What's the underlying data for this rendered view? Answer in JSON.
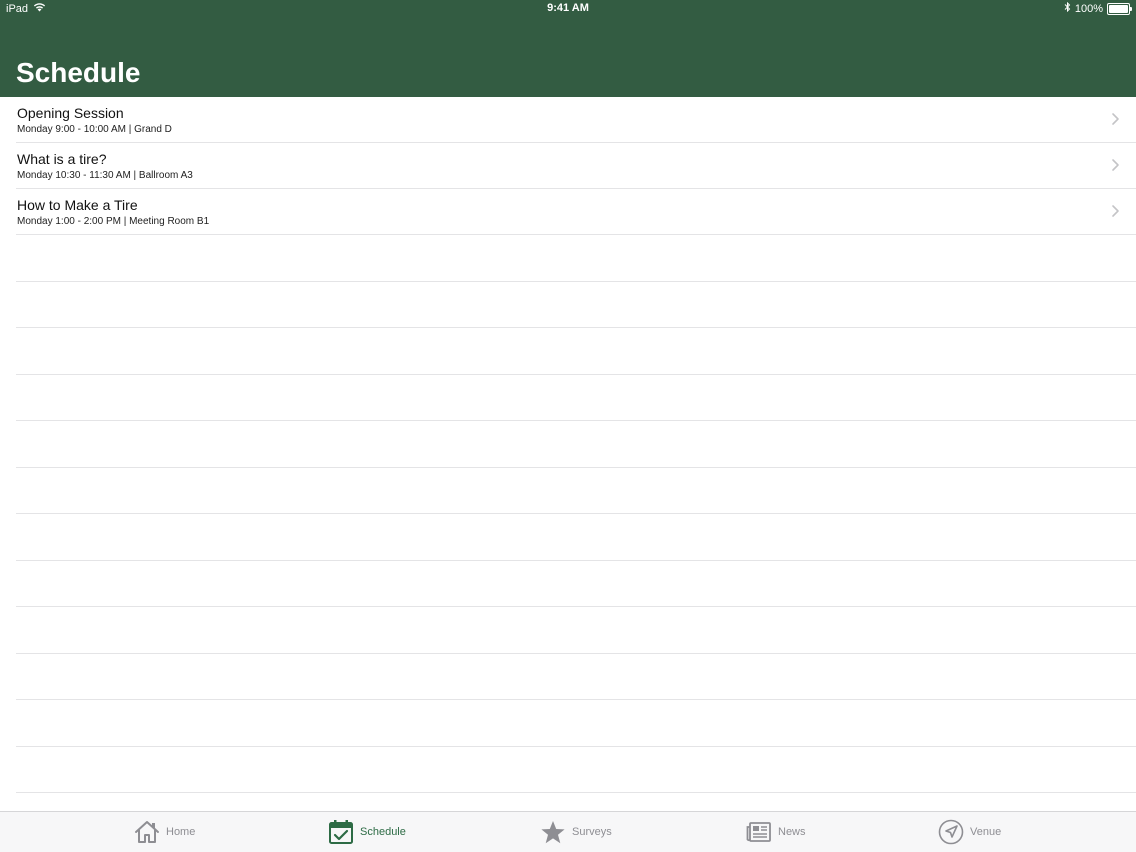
{
  "status_bar": {
    "device": "iPad",
    "time": "9:41 AM",
    "battery": "100%",
    "battery_level": 1.0
  },
  "header": {
    "title": "Schedule",
    "color": "#335c42"
  },
  "sessions": [
    {
      "title": "Opening Session",
      "subtitle": "Monday 9:00 - 10:00 AM | Grand D"
    },
    {
      "title": "What is a tire?",
      "subtitle": "Monday 10:30 - 11:30 AM | Ballroom A3"
    },
    {
      "title": "How to Make a Tire",
      "subtitle": "Monday 1:00 - 2:00 PM | Meeting Room B1"
    }
  ],
  "tabs": [
    {
      "label": "Home",
      "icon": "home-icon",
      "active": false
    },
    {
      "label": "Schedule",
      "icon": "calendar-check-icon",
      "active": true
    },
    {
      "label": "Surveys",
      "icon": "star-icon",
      "active": false
    },
    {
      "label": "News",
      "icon": "newspaper-icon",
      "active": false
    },
    {
      "label": "Venue",
      "icon": "location-arrow-icon",
      "active": false
    }
  ],
  "colors": {
    "accent": "#2d6b45",
    "tab_inactive": "#8e8e93",
    "separator": "#e4e4e6"
  }
}
